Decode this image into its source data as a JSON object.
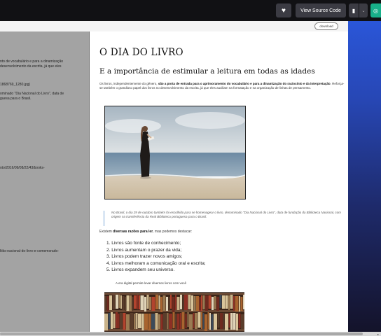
{
  "topbar": {
    "view_source_label": "View Source Code"
  },
  "toolbar": {
    "download_label": "download"
  },
  "source_pane": {
    "lines": [
      "nto de vocabulário e para a dinamização",
      "desenvolvimento da escrita, já que eles",
      "1868769_1280.jpg)",
      "ominado \"Dia Nacional do Livro\", data de",
      "guesa para o Brasil.",
      "oto/2016/09/08/22/43/books-",
      "ltiks-nacional-do-livro-e-comemorado-"
    ]
  },
  "article": {
    "title": "O DIA DO LIVRO",
    "subtitle": "E a importância de estimular a leitura em todas as idades",
    "intro_part1": "Os livros, independentemente do gênero, ",
    "intro_bold": "são a porta de entrada para o aprimoramento do vocabulário e para a dinamização do raciocínio e da interpretação",
    "intro_part2": ". Reforça-se também o grandioso papel dos livros no desenvolvimento da escrita, já que eles auxiliam na formatação e na organização de linhas de pensamento.",
    "quote": "No Brasil, o dia 29 de outubro também foi escolhido para se homenagear o livro, denominado \"Dia Nacional do Livro\", data de fundação da Biblioteca Nacional, com origem na transferência da Real Biblioteca portuguesa para o Brasil.",
    "reasons_prefix": "Existem ",
    "reasons_bold": "diversas razões para ler",
    "reasons_suffix": ", mas podemos destacar:",
    "reasons_list": [
      "1. Livros são fonte de conhecimento;",
      "2. Livros aumentam o prazer da vida;",
      "3. Livros podem trazer novos amigos;",
      "4. Livros melhoram a comunicação oral e escrita;",
      "5. Livros expandem seu universo."
    ],
    "image_caption": "A era digital permite levar diversos livros com você"
  },
  "icons": {
    "heart": "heart-icon",
    "pin": "pin-icon",
    "chevron": "chevron-down-icon",
    "app": "app-icon"
  },
  "colors": {
    "topbar": "#111114",
    "button": "#3b3b43",
    "teal": "#18b08a",
    "source_bg": "#a3a3a3",
    "quote_border": "#7ea9d9"
  }
}
